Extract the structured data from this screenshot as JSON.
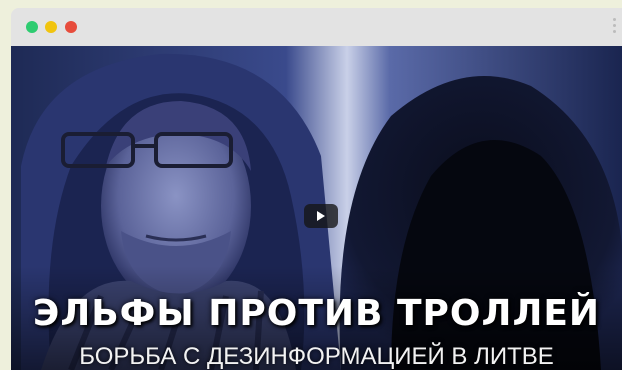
{
  "window": {
    "controls": {
      "close_color": "#2ecc71",
      "minimize_color": "#f1c40f",
      "maximize_color": "#e74c3c"
    },
    "menu_icon": "more-vertical-icon"
  },
  "video": {
    "title": "ЭЛЬФЫ ПРОТИВ ТРОЛЛЕЙ",
    "subtitle": "БОРЬБА С ДЕЗИНФОРМАЦИЕЙ В ЛИТВЕ",
    "play_icon": "play-icon",
    "tint_color": "#2b3a78"
  }
}
